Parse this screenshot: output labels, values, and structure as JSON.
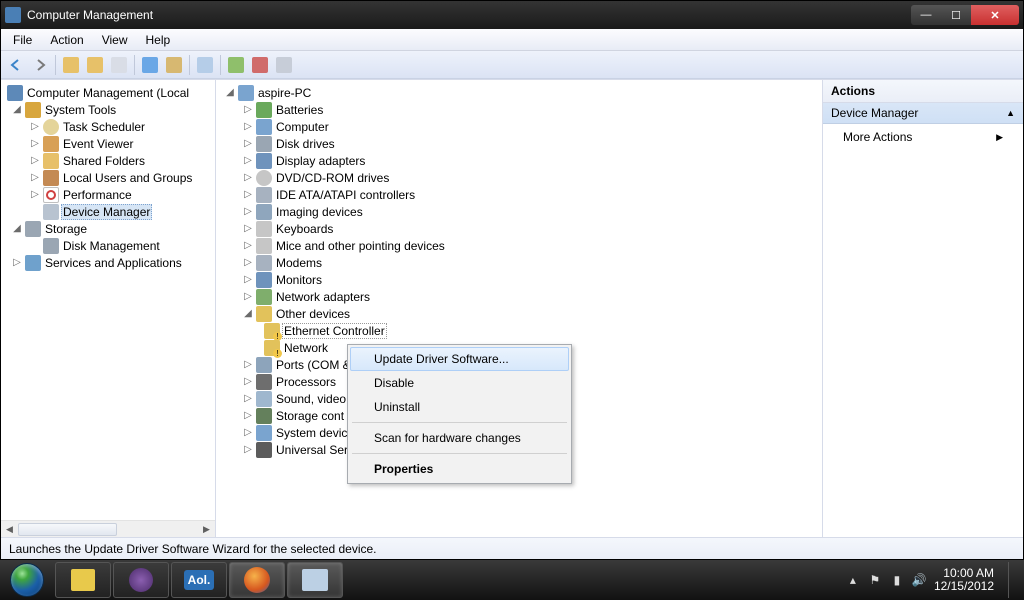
{
  "window": {
    "title": "Computer Management"
  },
  "menubar": [
    "File",
    "Action",
    "View",
    "Help"
  ],
  "left_tree": {
    "root": "Computer Management (Local",
    "groups": [
      {
        "label": "System Tools",
        "children": [
          "Task Scheduler",
          "Event Viewer",
          "Shared Folders",
          "Local Users and Groups",
          "Performance",
          "Device Manager"
        ],
        "expanded": true,
        "selected_index": 5
      },
      {
        "label": "Storage",
        "children": [
          "Disk Management"
        ],
        "expanded": true
      },
      {
        "label": "Services and Applications",
        "children": [],
        "expanded": false
      }
    ]
  },
  "mid_tree": {
    "root": "aspire-PC",
    "items": [
      {
        "label": "Batteries"
      },
      {
        "label": "Computer"
      },
      {
        "label": "Disk drives"
      },
      {
        "label": "Display adapters"
      },
      {
        "label": "DVD/CD-ROM drives"
      },
      {
        "label": "IDE ATA/ATAPI controllers"
      },
      {
        "label": "Imaging devices"
      },
      {
        "label": "Keyboards"
      },
      {
        "label": "Mice and other pointing devices"
      },
      {
        "label": "Modems"
      },
      {
        "label": "Monitors"
      },
      {
        "label": "Network adapters"
      },
      {
        "label": "Other devices",
        "expanded": true,
        "children": [
          {
            "label": "Ethernet Controller",
            "warn": true,
            "selected": true
          },
          {
            "label": "Network",
            "warn": true
          }
        ]
      },
      {
        "label": "Ports (COM &"
      },
      {
        "label": "Processors"
      },
      {
        "label": "Sound, video"
      },
      {
        "label": "Storage cont"
      },
      {
        "label": "System devic"
      },
      {
        "label": "Universal Ser"
      }
    ]
  },
  "context_menu": {
    "items": [
      {
        "label": "Update Driver Software...",
        "highlight": true
      },
      {
        "label": "Disable"
      },
      {
        "label": "Uninstall"
      },
      {
        "sep": true
      },
      {
        "label": "Scan for hardware changes"
      },
      {
        "sep": true
      },
      {
        "label": "Properties",
        "bold": true
      }
    ]
  },
  "actions": {
    "header": "Actions",
    "section": "Device Manager",
    "item": "More Actions"
  },
  "status": "Launches the Update Driver Software Wizard for the selected device.",
  "tray": {
    "time": "10:00 AM",
    "date": "12/15/2012"
  }
}
